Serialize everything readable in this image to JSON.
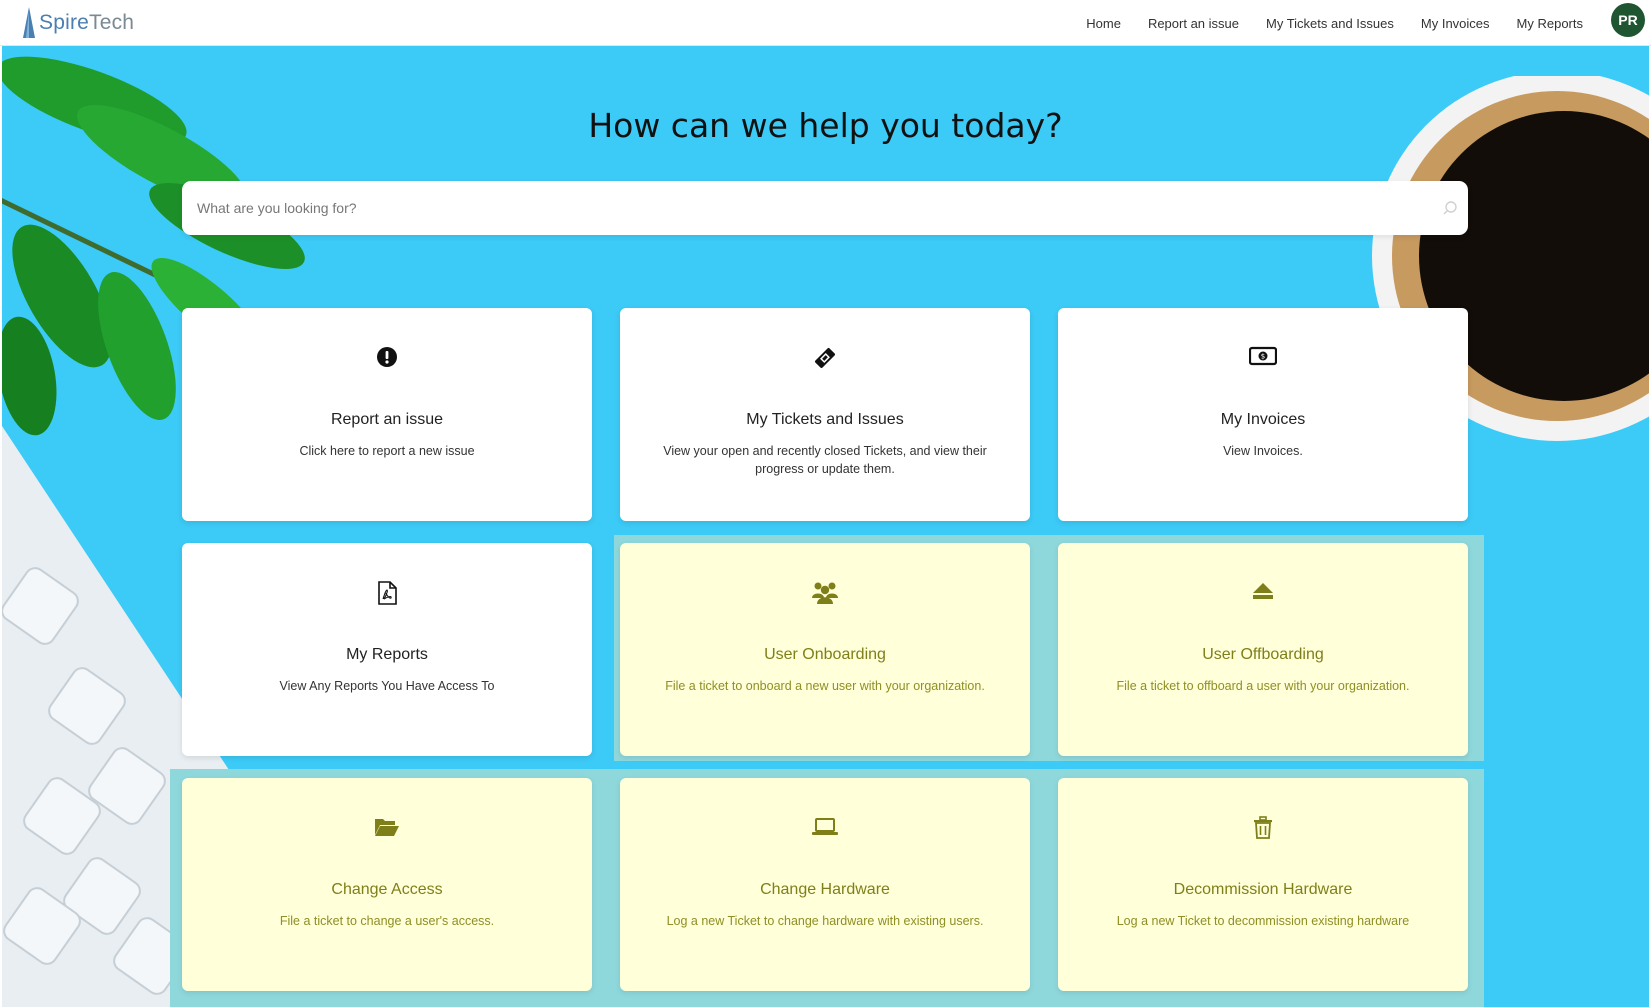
{
  "header": {
    "logo": {
      "brand_a": "Spire",
      "brand_b": "Tech"
    },
    "nav": [
      {
        "label": "Home"
      },
      {
        "label": "Report an issue"
      },
      {
        "label": "My Tickets and Issues"
      },
      {
        "label": "My Invoices"
      },
      {
        "label": "My Reports"
      }
    ],
    "avatar_initials": "PR"
  },
  "hero": {
    "headline": "How can we help you today?",
    "search": {
      "placeholder": "What are you looking for?",
      "value": ""
    }
  },
  "cards": [
    {
      "icon": "exclamation-circle-icon",
      "title": "Report an issue",
      "description": "Click here to report a new issue",
      "style": "white"
    },
    {
      "icon": "ticket-icon",
      "title": "My Tickets and Issues",
      "description": "View your open and recently closed Tickets, and view their progress or update them.",
      "style": "white"
    },
    {
      "icon": "money-bill-icon",
      "title": "My Invoices",
      "description": "View Invoices.",
      "style": "white"
    },
    {
      "icon": "pdf-file-icon",
      "title": "My Reports",
      "description": "View Any Reports You Have Access To",
      "style": "white"
    },
    {
      "icon": "users-icon",
      "title": "User Onboarding",
      "description": "File a ticket to onboard a new user with your organization.",
      "style": "yellow"
    },
    {
      "icon": "eject-icon",
      "title": "User Offboarding",
      "description": "File a ticket to offboard a user with your organization.",
      "style": "yellow"
    },
    {
      "icon": "folder-open-icon",
      "title": "Change Access",
      "description": "File a ticket to change a user's access.",
      "style": "yellow"
    },
    {
      "icon": "laptop-icon",
      "title": "Change Hardware",
      "description": "Log a new Ticket to change hardware with existing users.",
      "style": "yellow"
    },
    {
      "icon": "trash-icon",
      "title": "Decommission Hardware",
      "description": "Log a new Ticket to decommission existing hardware",
      "style": "yellow"
    }
  ],
  "colors": {
    "hero_background": "#3ccaf6",
    "avatar_background": "#1f5631",
    "highlight_card": "#ffffd9",
    "highlight_text": "#7f7f1a",
    "highlight_border": "#8ed8dc"
  }
}
